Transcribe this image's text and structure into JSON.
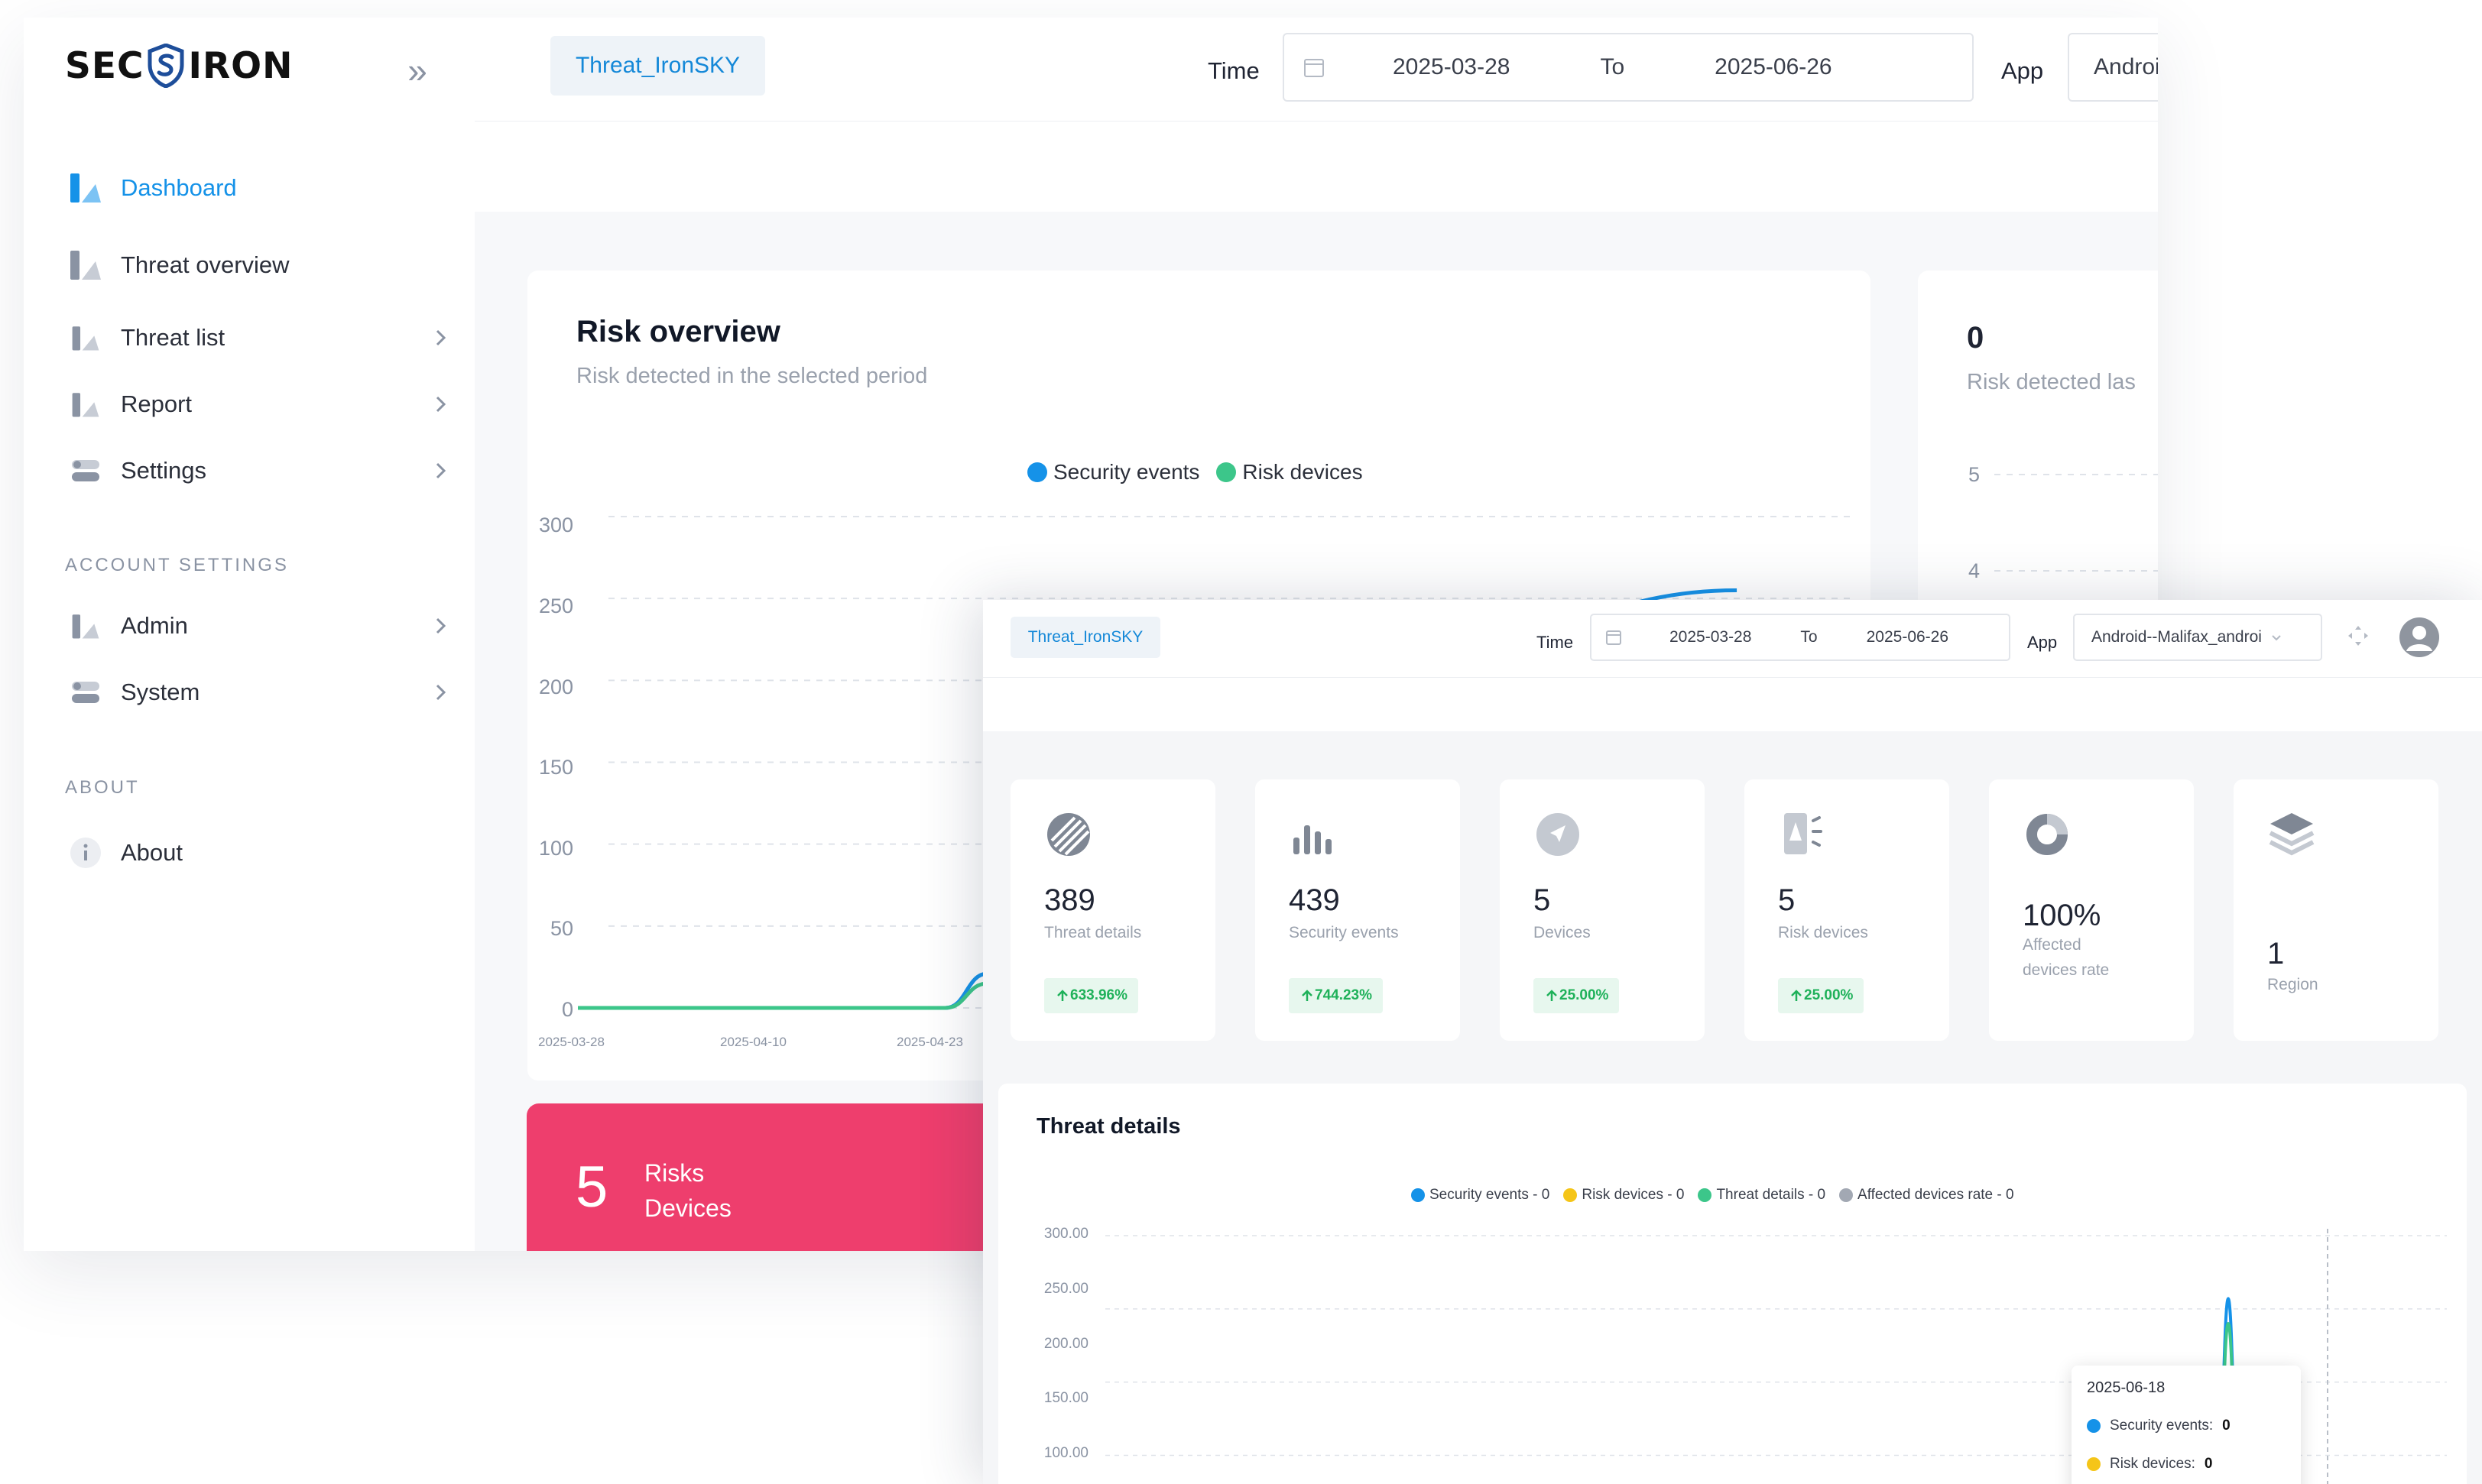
{
  "brand": {
    "left": "SEC",
    "right": "IRON"
  },
  "sidebar": {
    "items": [
      {
        "label": "Dashboard"
      },
      {
        "label": "Threat overview"
      },
      {
        "label": "Threat list"
      },
      {
        "label": "Report"
      },
      {
        "label": "Settings"
      }
    ],
    "account_title": "ACCOUNT SETTINGS",
    "account_items": [
      {
        "label": "Admin"
      },
      {
        "label": "System"
      }
    ],
    "about_title": "ABOUT",
    "about_items": [
      {
        "label": "About"
      }
    ]
  },
  "topbar": {
    "tag": "Threat_IronSKY",
    "time_label": "Time",
    "date_from": "2025-03-28",
    "date_to_label": "To",
    "date_to": "2025-06-26",
    "app_label": "App",
    "app_value": "Android"
  },
  "risk_overview": {
    "title": "Risk overview",
    "subtitle": "Risk detected in the selected period",
    "legend": [
      "Security events",
      "Risk devices"
    ],
    "colors": {
      "security": "#1592e8",
      "risk": "#3cc68a"
    }
  },
  "side_card": {
    "value": "0",
    "label": "Risk detected las",
    "ticks": [
      "5",
      "4"
    ]
  },
  "risk_card": {
    "value": "5",
    "line1": "Risks",
    "line2": "Devices"
  },
  "front": {
    "topbar": {
      "tag": "Threat_IronSKY",
      "time_label": "Time",
      "date_from": "2025-03-28",
      "date_to_label": "To",
      "date_to": "2025-06-26",
      "app_label": "App",
      "app_value": "Android--Malifax_androi"
    },
    "stats": [
      {
        "value": "389",
        "label": "Threat details",
        "change": "633.96%",
        "icon": "threat-details-icon"
      },
      {
        "value": "439",
        "label": "Security events",
        "change": "744.23%",
        "icon": "bar-chart-icon"
      },
      {
        "value": "5",
        "label": "Devices",
        "change": "25.00%",
        "icon": "compass-icon"
      },
      {
        "value": "5",
        "label": "Risk devices",
        "change": "25.00%",
        "icon": "phone-alert-icon"
      },
      {
        "value": "100%",
        "label_line1": "Affected",
        "label_line2": "devices rate",
        "icon": "donut-icon"
      },
      {
        "value": "1",
        "label": "Region",
        "icon": "layers-icon"
      }
    ],
    "threat_details": {
      "title": "Threat details",
      "legend": [
        {
          "label": "Security events - 0",
          "color": "#1592e8"
        },
        {
          "label": "Risk devices - 0",
          "color": "#f5c518"
        },
        {
          "label": "Threat details - 0",
          "color": "#3cc68a"
        },
        {
          "label": "Affected devices rate - 0",
          "color": "#a2a8b3"
        }
      ],
      "tooltip": {
        "date": "2025-06-18",
        "rows": [
          {
            "label": "Security events:",
            "value": "0"
          },
          {
            "label": "Risk devices:",
            "value": "0"
          }
        ]
      }
    }
  },
  "chart_data": [
    {
      "type": "line",
      "title": "Risk overview",
      "subtitle": "Risk detected in the selected period",
      "x_ticks": [
        "2025-03-28",
        "2025-04-10",
        "2025-04-23"
      ],
      "y_ticks": [
        "300",
        "250",
        "200",
        "150",
        "100",
        "50",
        "0"
      ],
      "ylim": [
        0,
        300
      ],
      "grid": true,
      "legend_position": "top-center",
      "series": [
        {
          "name": "Security events",
          "color": "#1592e8",
          "points": [
            [
              "2025-03-28",
              0
            ],
            [
              "2025-04-23",
              0
            ],
            [
              "2025-04-26",
              21
            ],
            [
              "2025-04-28",
              0
            ],
            [
              "2025-06-18",
              255
            ]
          ]
        },
        {
          "name": "Risk devices",
          "color": "#3cc68a",
          "points": [
            [
              "2025-03-28",
              0
            ],
            [
              "2025-04-23",
              0
            ],
            [
              "2025-04-26",
              15
            ],
            [
              "2025-04-28",
              0
            ]
          ]
        }
      ]
    },
    {
      "type": "line",
      "title": "Threat details",
      "y_ticks": [
        "300.00",
        "250.00",
        "200.00",
        "150.00",
        "100.00"
      ],
      "ylim": [
        0,
        300
      ],
      "grid": true,
      "legend_position": "top-center",
      "series": [
        {
          "name": "Security events - 0",
          "color": "#1592e8",
          "peak": {
            "x": "2025-06-18",
            "y": 257
          }
        },
        {
          "name": "Threat details - 0",
          "color": "#3cc68a",
          "peak": {
            "x": "2025-06-18",
            "y": 240
          }
        }
      ]
    }
  ]
}
